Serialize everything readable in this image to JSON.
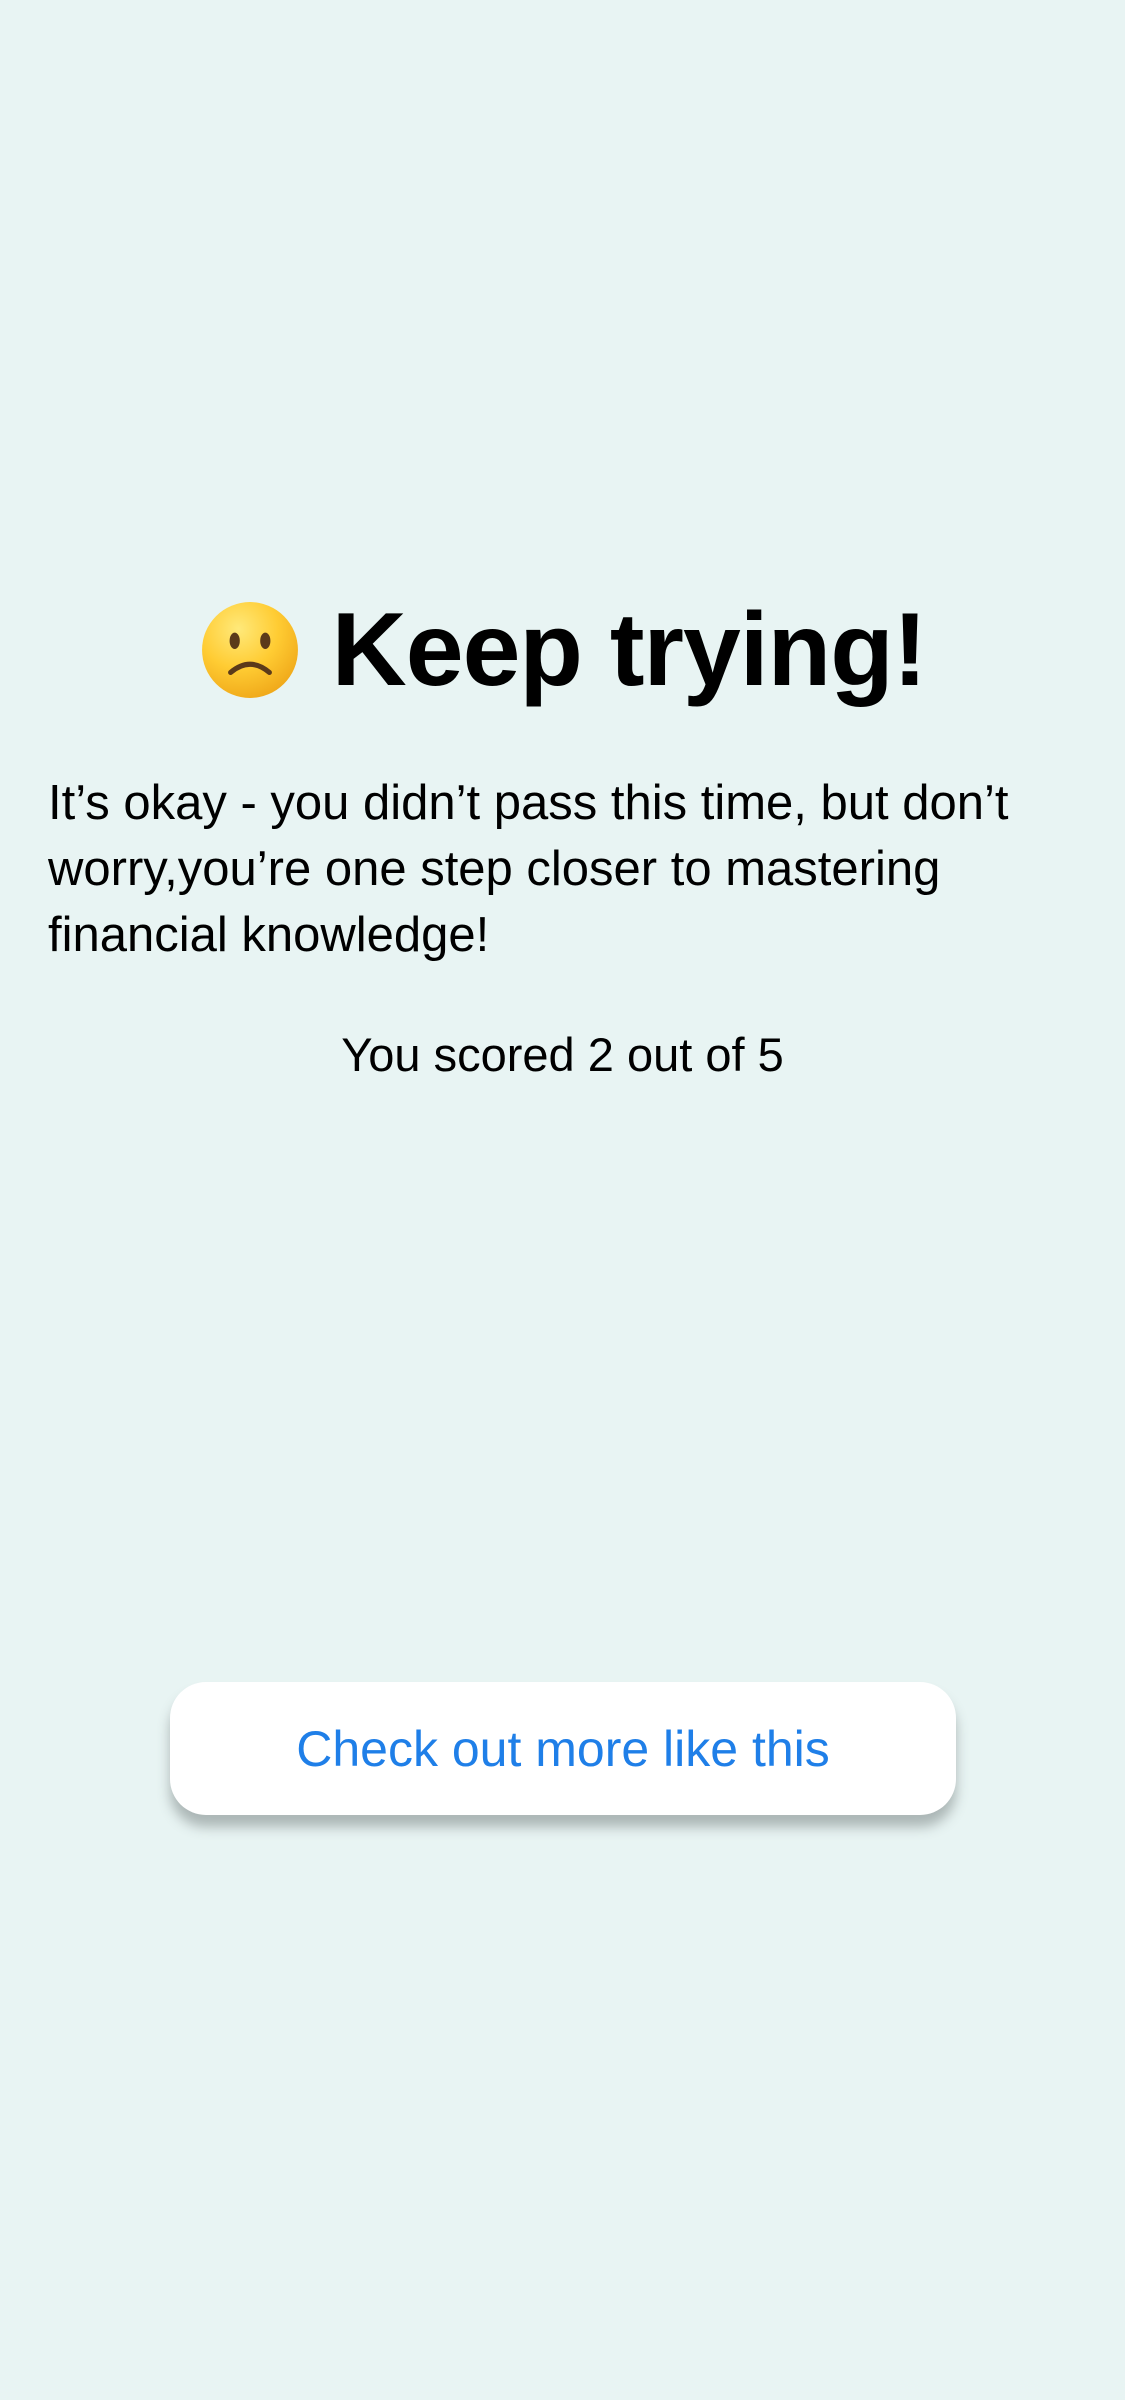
{
  "colors": {
    "background": "#E8F4F3",
    "button_background": "#FFFFFF",
    "accent": "#1F7FE8",
    "text": "#000000"
  },
  "result": {
    "emoji_icon": "slightly-frowning-face-icon",
    "title": "Keep trying!",
    "message": "It’s okay - you didn’t pass this time, but don’t worry,you’re one step closer to mastering financial knowledge!",
    "score_text": "You scored 2 out of 5",
    "score": 2,
    "total": 5
  },
  "cta": {
    "label": "Check out more like this"
  }
}
